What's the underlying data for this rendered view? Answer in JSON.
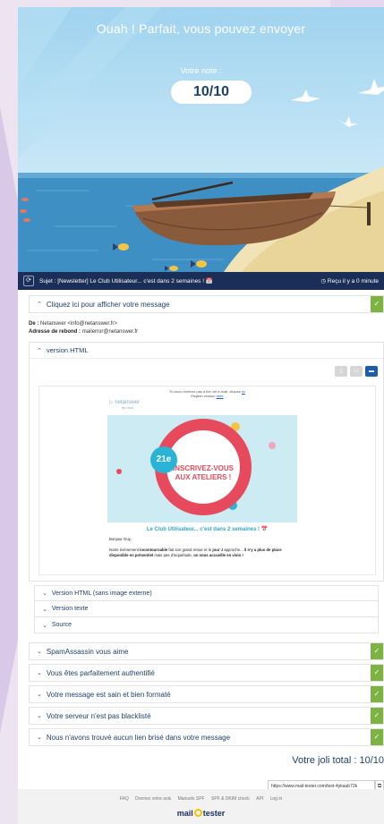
{
  "hero": {
    "title": "Ouah ! Parfait, vous pouvez envoyer",
    "score_label": "Votre note :",
    "score": "10/10"
  },
  "subject_bar": {
    "subject": "Sujet : [Newsletter] Le Club Utilisateur... c'est dans 2 semaines ! 📅",
    "received": "Reçu il y a 0 minute"
  },
  "message_toggle": {
    "label": "Cliquez ici pour afficher votre message"
  },
  "from": {
    "from_label": "De :",
    "from_value": "Netanswer <info@netanswer.fr>",
    "bounce_label": "Adresse de rebond :",
    "bounce_value": "mailerror@netanswer.fr"
  },
  "html_version": {
    "label": "version HTML",
    "email": {
      "top_line": "Si vous n'arrivez pas à lire cet e-mail, cliquez",
      "top_link": "ici",
      "english_line": "English version",
      "english_link": "here",
      "logo": "netanswer",
      "logo_sub": "by mcd",
      "badge": "21e",
      "banner_line1": "INSCRIVEZ-VOUS",
      "banner_line2": "AUX ATELIERS !",
      "club_title": "Le Club Utilisateur... c'est dans 2 semaines ! 📅",
      "greeting": "Bonjour Guy,",
      "paragraph_a": "Notre évènement ",
      "paragraph_b": "incontournable",
      "paragraph_c": " fait son grand retour et le ",
      "paragraph_d": "jour J",
      "paragraph_e": " approche... ",
      "paragraph_f": "il n'y a plus de place disponible en présentiel",
      "paragraph_g": " mais pas d'inquiétude, ",
      "paragraph_h": "on vous accueille en visio !"
    }
  },
  "sub_sections": [
    {
      "label": "Version HTML (sans image externe)"
    },
    {
      "label": "Version texte"
    },
    {
      "label": "Source"
    }
  ],
  "checks": [
    {
      "label": "SpamAssassin vous aime"
    },
    {
      "label": "Vous êtes parfaitement authentifié"
    },
    {
      "label": "Votre message est sain et bien formaté"
    },
    {
      "label": "Votre serveur n'est pas blacklisté"
    },
    {
      "label": "Nous n'avons trouvé aucun lien brisé dans votre message"
    }
  ],
  "total": "Votre joli total : 10/10",
  "share_url": "https://www.mail-tester.com/test-4ykaub72k",
  "footer": {
    "links": [
      "FAQ",
      "Donnez votre avis",
      "Manuels SPF",
      "SPF & DKIM check",
      "API",
      "Log in"
    ],
    "brand_a": "mail",
    "brand_b": "tester"
  },
  "colors": {
    "success": "#7cb342",
    "navy": "#1b2e57",
    "accent_red": "#e64a5c",
    "accent_cyan": "#2ab3d6"
  }
}
